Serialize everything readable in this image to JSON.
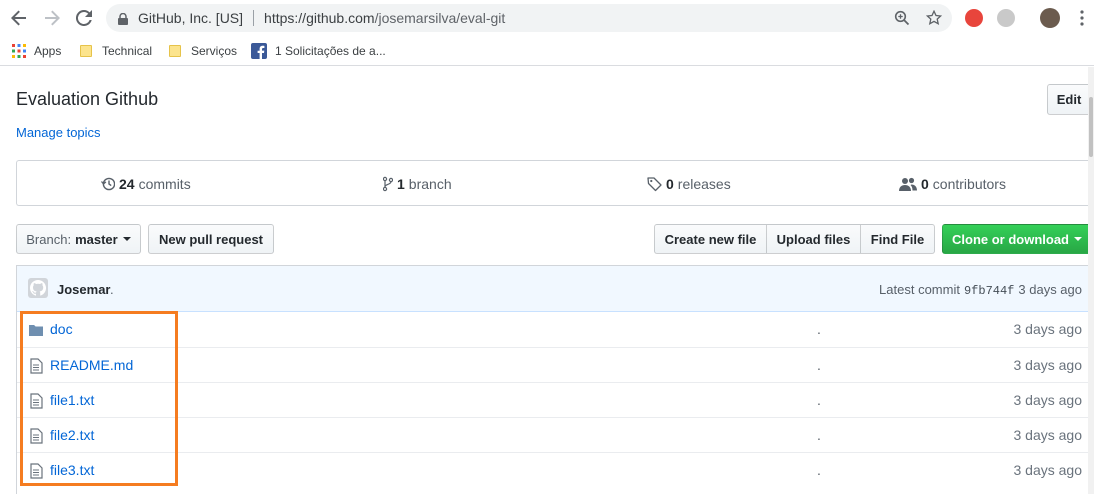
{
  "browser": {
    "site_identity": "GitHub, Inc. [US]",
    "url_host": "https://github.com",
    "url_path": "/josemarsilva/eval-git",
    "bookmarks": [
      {
        "label": "Apps",
        "icon": "apps-grid-icon"
      },
      {
        "label": "Technical",
        "icon": "folder-icon"
      },
      {
        "label": "Serviços",
        "icon": "folder-icon"
      },
      {
        "label": "1 Solicitações de a...",
        "icon": "facebook-icon"
      }
    ]
  },
  "repo": {
    "description": "Evaluation Github",
    "manage_topics": "Manage topics",
    "edit_label": "Edit"
  },
  "summary": {
    "commits_count": "24",
    "commits_label": "commits",
    "branch_count": "1",
    "branch_label": "branch",
    "releases_count": "0",
    "releases_label": "releases",
    "contributors_count": "0",
    "contributors_label": "contributors"
  },
  "actions": {
    "branch_prefix": "Branch:",
    "branch_name": "master",
    "new_pull_request": "New pull request",
    "create_new_file": "Create new file",
    "upload_files": "Upload files",
    "find_file": "Find File",
    "clone_or_download": "Clone or download"
  },
  "commit": {
    "author": "Josemar",
    "author_suffix": ".",
    "latest_label": "Latest commit",
    "sha": "9fb744f",
    "age": "3 days ago"
  },
  "files": [
    {
      "name": "doc",
      "type": "folder",
      "message": ".",
      "age": "3 days ago"
    },
    {
      "name": "README.md",
      "type": "file",
      "message": ".",
      "age": "3 days ago"
    },
    {
      "name": "file1.txt",
      "type": "file",
      "message": ".",
      "age": "3 days ago"
    },
    {
      "name": "file2.txt",
      "type": "file",
      "message": ".",
      "age": "3 days ago"
    },
    {
      "name": "file3.txt",
      "type": "file",
      "message": ".",
      "age": "3 days ago"
    }
  ],
  "colors": {
    "link": "#0366d6",
    "green_button": "#28a745",
    "highlight": "#f57c20",
    "commit_bar": "#f1f8ff"
  }
}
